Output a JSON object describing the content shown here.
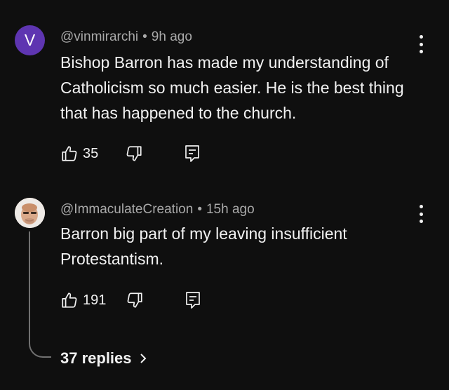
{
  "comments": [
    {
      "avatar_letter": "V",
      "avatar_color": "#5e35b1",
      "handle": "@vinmirarchi",
      "separator": "•",
      "time": "9h ago",
      "text": "Bishop Barron has made my understanding of Catholicism so much easier. He is the best thing that has happened to the church.",
      "likes": "35",
      "icons": [
        "thumbs-up-icon",
        "thumbs-down-icon",
        "reply-icon",
        "more-vert-icon"
      ]
    },
    {
      "avatar_letter": "",
      "handle": "@ImmaculateCreation",
      "separator": "•",
      "time": "15h ago",
      "text": "Barron big part of my leaving insufficient Protestantism.",
      "likes": "191",
      "icons": [
        "thumbs-up-icon",
        "thumbs-down-icon",
        "reply-icon",
        "more-vert-icon"
      ]
    }
  ],
  "replies": {
    "label": "37 replies",
    "icon": "chevron-right-icon"
  }
}
